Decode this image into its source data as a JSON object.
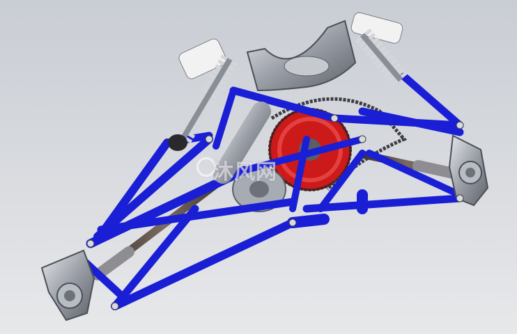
{
  "scene": {
    "subject": "",
    "colors": {
      "background_top": "#c9cdd4",
      "background_bottom": "#e7e8ea",
      "frame_blue": "#1a1fd6",
      "sprocket_red": "#cc1a1a",
      "metal_gray": "#9a9ea6",
      "spring_white": "#f2f2f2",
      "axle_dark": "#5a4a45"
    }
  },
  "watermark": {
    "text": "沐风网"
  }
}
